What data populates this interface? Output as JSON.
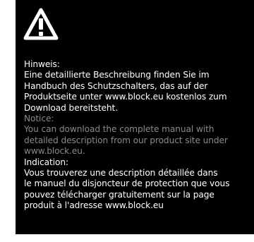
{
  "icon": {
    "name": "warning-icon",
    "color": "#ffffff",
    "background": "#000000"
  },
  "colors": {
    "panel_background": "#000000",
    "primary_text": "#ffffff",
    "secondary_text": "#8a8a8a"
  },
  "sections": {
    "de": {
      "heading": "Hinweis:",
      "lines": [
        "Eine detaillierte Beschreibung finden Sie im",
        "Handbuch des Schutzschalters, das auf der",
        "Produktseite unter www.block.eu kostenlos zum",
        "Download bereitsteht."
      ]
    },
    "en": {
      "heading": "Notice:",
      "lines": [
        "You can download the complete manual with",
        "detailed description from our product site under",
        "www.block.eu."
      ]
    },
    "fr": {
      "heading": "Indication:",
      "lines": [
        "Vous trouverez une description détaillée dans",
        "le manuel du disjoncteur de protection que vous",
        "pouvez télécharger gratuitement sur la page",
        "produit à l'adresse www.block.eu"
      ]
    }
  }
}
